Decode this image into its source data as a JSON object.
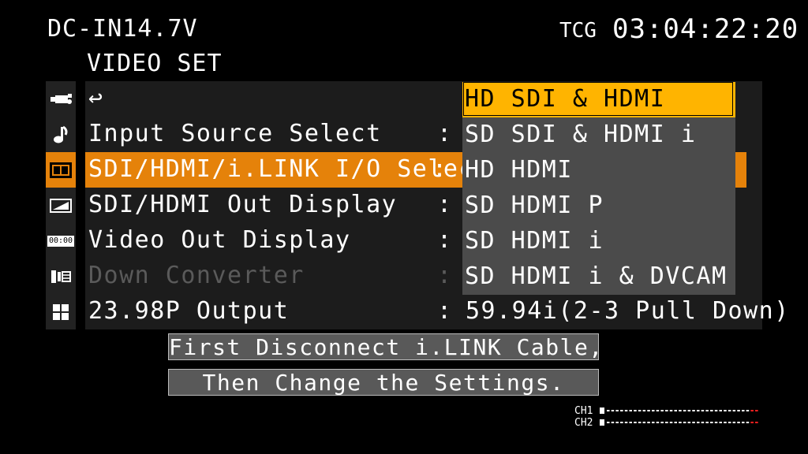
{
  "status": {
    "power": "DC-IN14.7V",
    "tcg_label": "TCG",
    "timecode": "03:04:22:20"
  },
  "menu": {
    "title": "VIDEO SET",
    "rows": [
      {
        "label": "↩",
        "colon": "",
        "value": ""
      },
      {
        "label": "Input Source Select",
        "colon": ":",
        "value": ""
      },
      {
        "label": "SDI/HDMI/i.LINK I/O Select",
        "colon": ":",
        "value": ""
      },
      {
        "label": "SDI/HDMI Out Display",
        "colon": ":",
        "value": ""
      },
      {
        "label": "Video Out Display",
        "colon": ":",
        "value": ""
      },
      {
        "label": "Down Converter",
        "colon": ":",
        "value": ""
      },
      {
        "label": "23.98P Output",
        "colon": ":",
        "value": "59.94i(2-3 Pull Down)"
      }
    ],
    "icons": [
      "camera-icon",
      "audio-note-icon",
      "film-strip-icon",
      "display-icon",
      "timecode-icon",
      "media-icon",
      "grid-icon"
    ],
    "icon_timecode_text": "00:00"
  },
  "dropdown": {
    "options": [
      "HD SDI & HDMI",
      "SD SDI & HDMI i",
      "HD HDMI",
      "SD HDMI P",
      "SD HDMI i",
      "SD HDMI i & DVCAM"
    ],
    "selected_index": 0
  },
  "messages": {
    "line1": "First Disconnect i.LINK Cable,",
    "line2": "Then Change the Settings."
  },
  "audio": {
    "ch1_label": "CH1",
    "ch2_label": "CH2"
  },
  "colors": {
    "highlight": "#e5820a",
    "dropdown_selected": "#ffb400",
    "meter_peak": "#ff2020"
  }
}
